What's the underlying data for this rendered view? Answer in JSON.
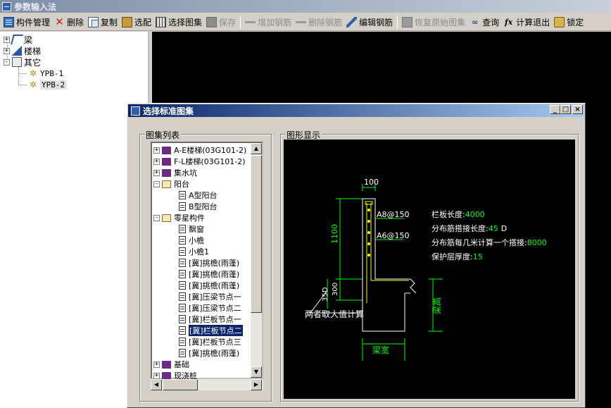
{
  "window": {
    "title": "参数输入法"
  },
  "toolbar": {
    "component_manage": "构件管理",
    "delete": "删除",
    "copy": "复制",
    "select_fit": "选配",
    "select_atlas": "选择图集",
    "save": "保存",
    "add_rebar": "增加钢筋",
    "delete_rebar": "删除钢筋",
    "edit_rebar": "编辑钢筋",
    "restore_atlas": "恢复原始图集",
    "query": "查询",
    "calc_exit": "计算退出",
    "lock": "锁定"
  },
  "tree": {
    "beam": "梁",
    "stair": "楼梯",
    "other": "其它",
    "ypb1": "YPB-1",
    "ypb2": "YPB-2"
  },
  "dialog": {
    "title": "选择标准图集",
    "catalog_label": "图集列表",
    "preview_label": "图形显示",
    "btn_min": "_",
    "btn_max": "□",
    "btn_close": "×"
  },
  "catalog": {
    "items": [
      {
        "label": "A-E楼梯(03G101-2)"
      },
      {
        "label": "F-L楼梯(03G101-2)"
      },
      {
        "label": "集水坑"
      },
      {
        "label": "阳台"
      },
      {
        "label": "A型阳台"
      },
      {
        "label": "B型阳台"
      },
      {
        "label": "零星构件"
      },
      {
        "label": "飘窗"
      },
      {
        "label": "小檐"
      },
      {
        "label": "小檐1"
      },
      {
        "label": "[冀]挑檐(雨蓬)"
      },
      {
        "label": "[冀]挑檐(雨蓬)"
      },
      {
        "label": "[冀]挑檐(雨蓬)"
      },
      {
        "label": "[冀]压梁节点一"
      },
      {
        "label": "[冀]压梁节点二"
      },
      {
        "label": "[冀]栏板节点一"
      },
      {
        "label": "[冀]栏板节点二"
      },
      {
        "label": "[冀]栏板节点三"
      },
      {
        "label": "[冀]挑檐(雨蓬)"
      },
      {
        "label": "基础"
      },
      {
        "label": "现浇桩"
      }
    ]
  },
  "preview": {
    "dim_top": "100",
    "dim_height": "1100",
    "dim_lower": "300",
    "dim_anchor": "35D",
    "rebar1": "A8@150",
    "rebar2": "A6@150",
    "note": "两者取大值计算",
    "beam_width": "梁宽",
    "beam_height": "梁高",
    "param1_label": "栏板长度:",
    "param1_value": "4000",
    "param2_label": "分布筋搭接长度:",
    "param2_value": "45",
    "param2_unit": "D",
    "param3_label": "分布筋每几米计算一个搭接:",
    "param3_value": "8000",
    "param4_label": "保护层厚度:",
    "param4_value": "15"
  },
  "colors": {
    "cad_green": "#00ff00",
    "cad_yellow": "#ffff00",
    "cad_white": "#ffffff"
  }
}
